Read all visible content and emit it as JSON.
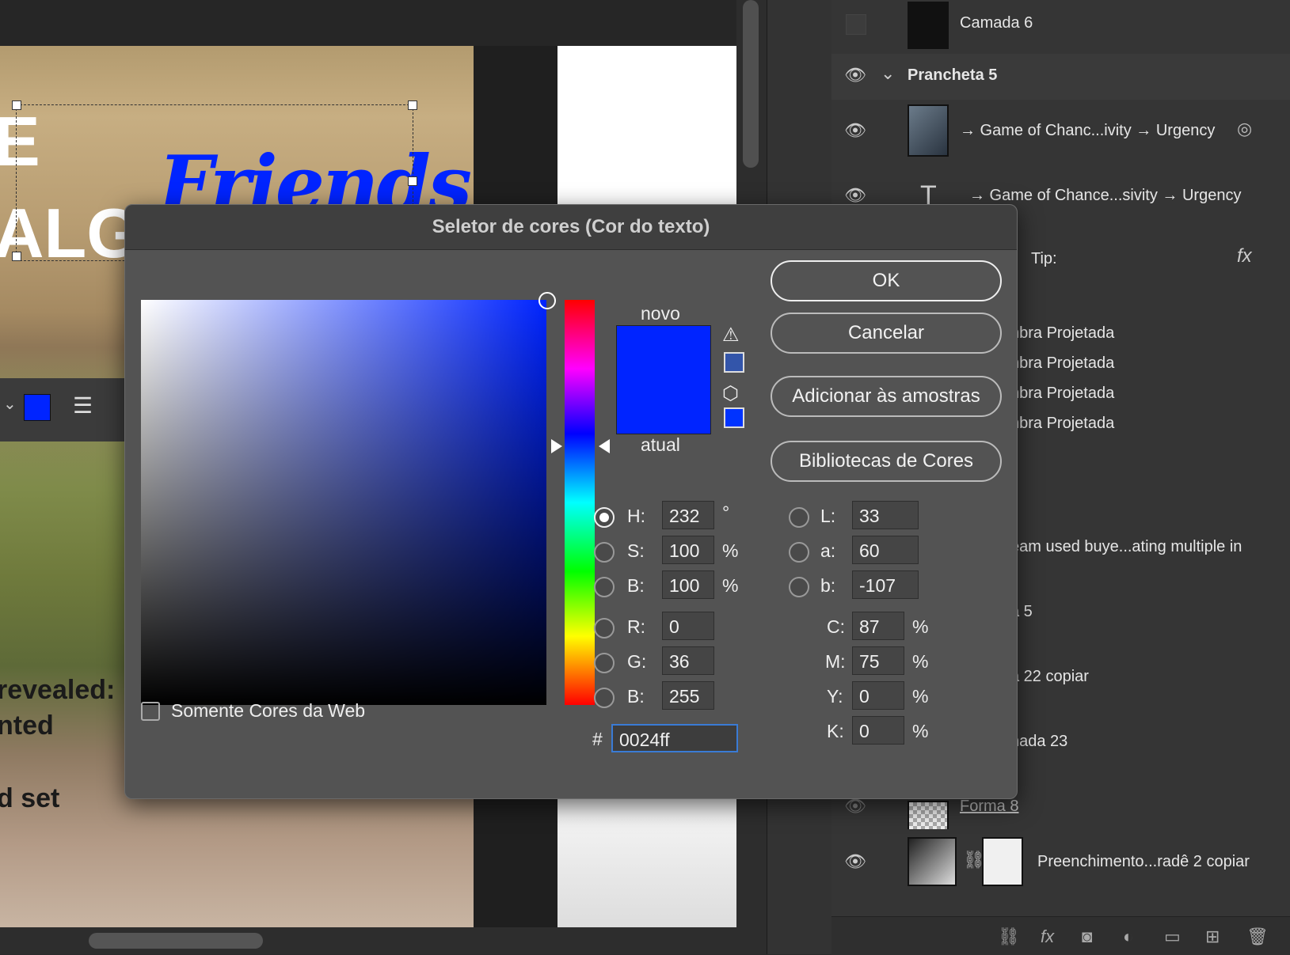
{
  "canvas": {
    "headline_text": "Friends",
    "big_left_1": "E",
    "big_left_2": "ALG",
    "text_revealed": "revealed:",
    "text_nted": "nted",
    "text_set": "d set",
    "text_color_hex": "#0024ff"
  },
  "layers": {
    "rows": [
      {
        "name": "Camada 6"
      },
      {
        "name": "Prancheta 5"
      },
      {
        "name": "→ Game of Chanc...ivity → Urgency"
      },
      {
        "name": "→ Game of Chance...sivity → Urgency"
      },
      {
        "name": "Tip:"
      },
      {
        "name": "nbra Projetada"
      },
      {
        "name": "nbra Projetada"
      },
      {
        "name": "nbra Projetada"
      },
      {
        "name": "nbra Projetada"
      },
      {
        "name": "eam used buye...ating multiple in"
      },
      {
        "name": "a 5"
      },
      {
        "name": "a 22 copiar"
      },
      {
        "name": "nada 23"
      },
      {
        "name": "Forma 8"
      },
      {
        "name": "Preenchimento...radê 2 copiar"
      }
    ],
    "fx_label": "fx"
  },
  "dialog": {
    "title": "Seletor de cores (Cor do texto)",
    "label_new": "novo",
    "label_current": "atual",
    "new_color": "#0024ff",
    "current_color": "#0024ff",
    "gamut_warning_color": "#3355aa",
    "web_safe_color": "#0033ff",
    "buttons": {
      "ok": "OK",
      "cancel": "Cancelar",
      "add_swatches": "Adicionar às amostras",
      "libraries": "Bibliotecas de Cores"
    },
    "web_only_label": "Somente Cores da Web",
    "hsb": {
      "h_label": "H:",
      "h": "232",
      "h_unit": "°",
      "s_label": "S:",
      "s": "100",
      "s_unit": "%",
      "b_label": "B:",
      "b": "100",
      "b_unit": "%"
    },
    "rgb": {
      "r_label": "R:",
      "r": "0",
      "g_label": "G:",
      "g": "36",
      "b_label": "B:",
      "b": "255"
    },
    "lab": {
      "l_label": "L:",
      "l": "33",
      "a_label": "a:",
      "a": "60",
      "b_label": "b:",
      "b": "-107"
    },
    "cmyk": {
      "c_label": "C:",
      "c": "87",
      "m_label": "M:",
      "m": "75",
      "y_label": "Y:",
      "y": "0",
      "k_label": "K:",
      "k": "0",
      "unit": "%"
    },
    "hex_label": "#",
    "hex_value": "0024ff"
  }
}
